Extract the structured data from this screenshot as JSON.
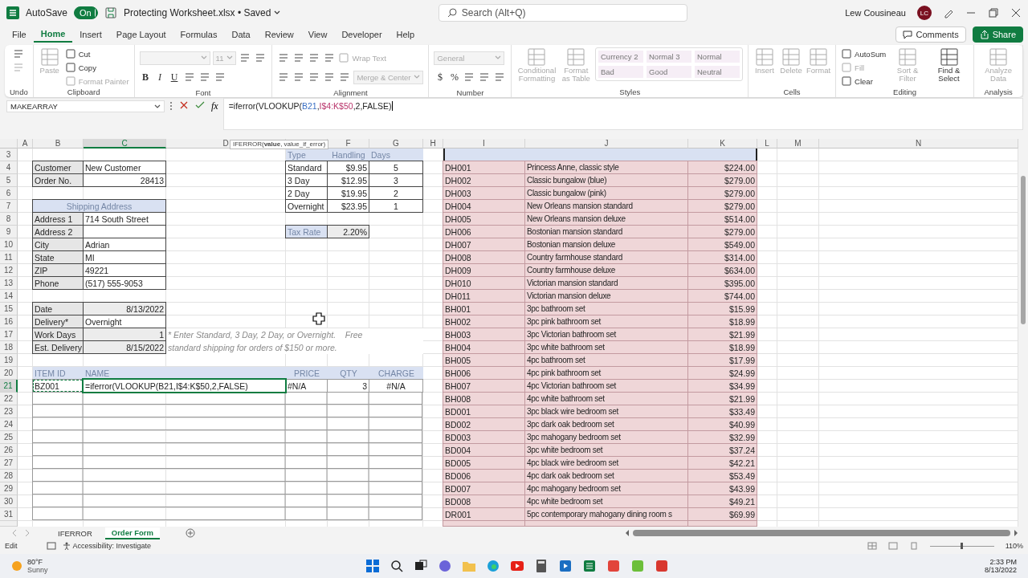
{
  "title_bar": {
    "autosave_label": "AutoSave",
    "autosave": {
      "on": true,
      "label": "On"
    },
    "document_title": "Protecting Worksheet.xlsx • Saved",
    "search_placeholder": "Search (Alt+Q)",
    "user_name": "Lew Cousineau",
    "user_initials": "LC"
  },
  "ribbon_tabs": [
    {
      "label": "File",
      "selected": false
    },
    {
      "label": "Home",
      "selected": true
    },
    {
      "label": "Insert",
      "selected": false
    },
    {
      "label": "Page Layout",
      "selected": false
    },
    {
      "label": "Formulas",
      "selected": false
    },
    {
      "label": "Data",
      "selected": false
    },
    {
      "label": "Review",
      "selected": false
    },
    {
      "label": "View",
      "selected": false
    },
    {
      "label": "Developer",
      "selected": false
    },
    {
      "label": "Help",
      "selected": false
    }
  ],
  "ribbon_buttons": [
    {
      "label": "Comments",
      "kind": "plain"
    },
    {
      "label": "Share",
      "kind": "primary"
    }
  ],
  "ribbon_groups": [
    {
      "name": "Undo",
      "kind": "columns",
      "items": [
        {
          "kind": "icon",
          "disabled": false
        },
        {
          "kind": "icon",
          "disabled": true
        }
      ]
    },
    {
      "name": "Clipboard",
      "kind": "columns",
      "items": [
        {
          "kind": "large",
          "label": "Paste",
          "disabled": true
        },
        {
          "kind": "small",
          "label": "Cut",
          "disabled": false
        },
        {
          "kind": "small",
          "label": "Copy",
          "disabled": false
        },
        {
          "kind": "small",
          "label": "Format Painter",
          "disabled": true
        }
      ]
    },
    {
      "name": "Font",
      "kind": "rows",
      "rows": [
        [
          {
            "kind": "wide-field",
            "disabled": true
          },
          {
            "kind": "field",
            "label": "11",
            "disabled": true
          },
          {
            "kind": "icon",
            "disabled": false
          },
          {
            "kind": "icon",
            "disabled": false
          }
        ],
        [
          {
            "kind": "bold",
            "label": "B",
            "disabled": false
          },
          {
            "kind": "italic",
            "label": "I",
            "disabled": false
          },
          {
            "kind": "underline",
            "label": "U",
            "disabled": false
          },
          {
            "kind": "icon",
            "disabled": false
          },
          {
            "kind": "icon",
            "disabled": false
          },
          {
            "kind": "icon",
            "disabled": false
          }
        ]
      ]
    },
    {
      "name": "Alignment",
      "kind": "rows",
      "rows": [
        [
          {
            "kind": "icon",
            "disabled": false
          },
          {
            "kind": "icon",
            "disabled": false
          },
          {
            "kind": "icon",
            "disabled": false
          },
          {
            "kind": "icon",
            "disabled": false
          },
          {
            "kind": "small",
            "label": "Wrap Text",
            "disabled": true
          }
        ],
        [
          {
            "kind": "icon",
            "disabled": false
          },
          {
            "kind": "icon",
            "disabled": false
          },
          {
            "kind": "icon",
            "disabled": false
          },
          {
            "kind": "icon",
            "disabled": false
          },
          {
            "kind": "icon",
            "disabled": false
          },
          {
            "kind": "field",
            "label": "Merge & Center",
            "disabled": true
          }
        ]
      ]
    },
    {
      "name": "Number",
      "kind": "rows",
      "rows": [
        [
          {
            "kind": "wide-field",
            "label": "General",
            "disabled": true
          }
        ],
        [
          {
            "kind": "glyph",
            "label": "$",
            "disabled": false
          },
          {
            "kind": "glyph",
            "label": "%",
            "disabled": false
          },
          {
            "kind": "icon",
            "disabled": false
          },
          {
            "kind": "icon",
            "disabled": false
          },
          {
            "kind": "icon",
            "disabled": false
          }
        ]
      ]
    },
    {
      "name": "Styles",
      "kind": "columns",
      "items": [
        {
          "kind": "large",
          "label": "Conditional Formatting",
          "disabled": true
        },
        {
          "kind": "large",
          "label": "Format as Table",
          "disabled": true
        },
        {
          "kind": "gallery",
          "styles": [
            "Currency 2",
            "Normal 3",
            "Normal",
            "Bad",
            "Good",
            "Neutral"
          ]
        }
      ]
    },
    {
      "name": "Cells",
      "kind": "columns",
      "items": [
        {
          "kind": "large",
          "label": "Insert",
          "disabled": true
        },
        {
          "kind": "large",
          "label": "Delete",
          "disabled": true
        },
        {
          "kind": "large",
          "label": "Format",
          "disabled": true
        }
      ]
    },
    {
      "name": "Editing",
      "kind": "columns",
      "items": [
        {
          "kind": "small",
          "label": "AutoSum",
          "disabled": false
        },
        {
          "kind": "small",
          "label": "Fill",
          "disabled": true
        },
        {
          "kind": "small",
          "label": "Clear",
          "disabled": false
        },
        {
          "kind": "large",
          "label": "Sort & Filter",
          "disabled": true
        },
        {
          "kind": "large",
          "label": "Find & Select",
          "disabled": false
        }
      ]
    },
    {
      "name": "Analysis",
      "kind": "columns",
      "items": [
        {
          "kind": "large",
          "label": "Analyze Data",
          "disabled": true
        }
      ]
    }
  ],
  "formula_bar": {
    "name_box": "MAKEARRAY",
    "function_label": "fx",
    "formula_parts": [
      {
        "text": "=iferror(VLOOKUP("
      },
      {
        "text": "B21",
        "color": "#3a6fc4"
      },
      {
        "text": ","
      },
      {
        "text": "I$4:K$50",
        "color": "#b8336a"
      },
      {
        "text": ",2,FALSE)"
      }
    ]
  },
  "tooltip": "IFERROR(**value**, value_if_error)",
  "sheet": {
    "column_headers": [
      {
        "label": "A",
        "selected": false
      },
      {
        "label": "B",
        "selected": false
      },
      {
        "label": "C",
        "selected": true
      },
      {
        "label": "D",
        "selected": false
      },
      {
        "label": "F",
        "selected": false
      },
      {
        "label": "G",
        "selected": false
      },
      {
        "label": "H",
        "selected": false
      },
      {
        "label": "I",
        "selected": false
      },
      {
        "label": "J",
        "selected": false
      },
      {
        "label": "K",
        "selected": false
      },
      {
        "label": "L",
        "selected": false
      },
      {
        "label": "M",
        "selected": false
      },
      {
        "label": "N",
        "selected": false
      }
    ],
    "row_numbers": [
      {
        "label": "3",
        "selected": false
      },
      {
        "label": "4",
        "selected": false
      },
      {
        "label": "5",
        "selected": false
      },
      {
        "label": "6",
        "selected": false
      },
      {
        "label": "7",
        "selected": false
      },
      {
        "label": "8",
        "selected": false
      },
      {
        "label": "9",
        "selected": false
      },
      {
        "label": "10",
        "selected": false
      },
      {
        "label": "11",
        "selected": false
      },
      {
        "label": "12",
        "selected": false
      },
      {
        "label": "13",
        "selected": false
      },
      {
        "label": "14",
        "selected": false
      },
      {
        "label": "15",
        "selected": false
      },
      {
        "label": "16",
        "selected": false
      },
      {
        "label": "17",
        "selected": false
      },
      {
        "label": "18",
        "selected": false
      },
      {
        "label": "19",
        "selected": false
      },
      {
        "label": "20",
        "selected": false
      },
      {
        "label": "21",
        "selected": true
      },
      {
        "label": "22",
        "selected": false
      },
      {
        "label": "23",
        "selected": false
      },
      {
        "label": "24",
        "selected": false
      },
      {
        "label": "25",
        "selected": false
      },
      {
        "label": "26",
        "selected": false
      },
      {
        "label": "27",
        "selected": false
      },
      {
        "label": "28",
        "selected": false
      },
      {
        "label": "29",
        "selected": false
      },
      {
        "label": "30",
        "selected": false
      },
      {
        "label": "31",
        "selected": false
      }
    ],
    "customer": [
      {
        "label": "Customer",
        "value": "New Customer",
        "kind": "text"
      },
      {
        "label": "Order No.",
        "value": "28413",
        "kind": "number"
      }
    ],
    "shipping_address": {
      "title": "Shipping Address",
      "fields": [
        {
          "label": "Address 1",
          "value": "714 South Street"
        },
        {
          "label": "Address 2"
        },
        {
          "label": "City",
          "value": "Adrian"
        },
        {
          "label": "State",
          "value": "MI"
        },
        {
          "label": "ZIP",
          "value": "49221"
        },
        {
          "label": "Phone",
          "value": "(517) 555-9053"
        }
      ]
    },
    "delivery": [
      {
        "label": "Date",
        "value": "8/13/2022",
        "kind": "number"
      },
      {
        "label": "Delivery*",
        "value": "Overnight",
        "kind": "text"
      },
      {
        "label": "Work Days",
        "value": "1",
        "kind": "number"
      },
      {
        "label": "Est. Delivery",
        "value": "8/15/2022",
        "kind": "number"
      }
    ],
    "note_lines": [
      "* Enter Standard, 3 Day, 2 Day, or Overnight.    Free",
      "standard shipping for orders of $150 or more."
    ],
    "shipping_rates": {
      "columns": [
        "Type",
        "Handling",
        "Days"
      ],
      "rows": [
        [
          "Standard",
          "$9.95",
          "5"
        ],
        [
          "3 Day",
          "$12.95",
          "3"
        ],
        [
          "2 Day",
          "$19.95",
          "2"
        ],
        [
          "Overnight",
          "$23.95",
          "1"
        ]
      ]
    },
    "tax": {
      "label": "Tax Rate",
      "value": "2.20%"
    },
    "order_items": {
      "columns": [
        "ITEM ID",
        "NAME",
        "PRICE",
        "QTY",
        "CHARGE"
      ],
      "rows": [
        {
          "item_id": "BZ001",
          "name": "=iferror(VLOOKUP(B21,I$4:K$50,2,FALSE)",
          "price": "#N/A",
          "qty": "3",
          "charge": "#N/A",
          "editing": true
        }
      ]
    },
    "catalog": [
      {
        "id": "DH001",
        "name": "Princess Anne, classic style",
        "price": "$224.00"
      },
      {
        "id": "DH002",
        "name": "Classic bungalow (blue)",
        "price": "$279.00"
      },
      {
        "id": "DH003",
        "name": "Classic bungalow (pink)",
        "price": "$279.00"
      },
      {
        "id": "DH004",
        "name": "New Orleans mansion standard",
        "price": "$279.00"
      },
      {
        "id": "DH005",
        "name": "New Orleans mansion deluxe",
        "price": "$514.00"
      },
      {
        "id": "DH006",
        "name": "Bostonian mansion standard",
        "price": "$279.00"
      },
      {
        "id": "DH007",
        "name": "Bostonian mansion deluxe",
        "price": "$549.00"
      },
      {
        "id": "DH008",
        "name": "Country farmhouse standard",
        "price": "$314.00"
      },
      {
        "id": "DH009",
        "name": "Country farmhouse deluxe",
        "price": "$634.00"
      },
      {
        "id": "DH010",
        "name": "Victorian mansion standard",
        "price": "$395.00"
      },
      {
        "id": "DH011",
        "name": "Victorian mansion deluxe",
        "price": "$744.00"
      },
      {
        "id": "BH001",
        "name": "3pc bathroom set",
        "price": "$15.99"
      },
      {
        "id": "BH002",
        "name": "3pc pink bathroom set",
        "price": "$18.99"
      },
      {
        "id": "BH003",
        "name": "3pc Victorian bathroom set",
        "price": "$21.99"
      },
      {
        "id": "BH004",
        "name": "3pc white bathroom set",
        "price": "$18.99"
      },
      {
        "id": "BH005",
        "name": "4pc bathroom set",
        "price": "$17.99"
      },
      {
        "id": "BH006",
        "name": "4pc pink bathroom set",
        "price": "$24.99"
      },
      {
        "id": "BH007",
        "name": "4pc Victorian bathroom set",
        "price": "$34.99"
      },
      {
        "id": "BH008",
        "name": "4pc white bathroom set",
        "price": "$21.99"
      },
      {
        "id": "BD001",
        "name": "3pc black wire bedroom set",
        "price": "$33.49"
      },
      {
        "id": "BD002",
        "name": "3pc dark oak bedroom set",
        "price": "$40.99"
      },
      {
        "id": "BD003",
        "name": "3pc mahogany bedroom set",
        "price": "$32.99"
      },
      {
        "id": "BD004",
        "name": "3pc white bedroom set",
        "price": "$37.24"
      },
      {
        "id": "BD005",
        "name": "4pc black wire bedroom set",
        "price": "$42.21"
      },
      {
        "id": "BD006",
        "name": "4pc dark oak bedroom set",
        "price": "$53.49"
      },
      {
        "id": "BD007",
        "name": "4pc mahogany bedroom set",
        "price": "$43.99"
      },
      {
        "id": "BD008",
        "name": "4pc white bedroom set",
        "price": "$49.21"
      },
      {
        "id": "DR001",
        "name": "5pc contemporary mahogany dining room s",
        "price": "$69.99"
      }
    ]
  },
  "sheet_tabs": [
    {
      "label": "IFERROR",
      "selected": false
    },
    {
      "label": "Order Form",
      "selected": true
    }
  ],
  "status_bar": {
    "mode": "Edit",
    "accessibility": "Accessibility: Investigate",
    "zoom": "110%",
    "zoom_slider": {
      "level": 0.5
    }
  },
  "taskbar": {
    "temperature": "80°F",
    "weather": "Sunny",
    "time": "2:33 PM",
    "date": "8/13/2022"
  }
}
